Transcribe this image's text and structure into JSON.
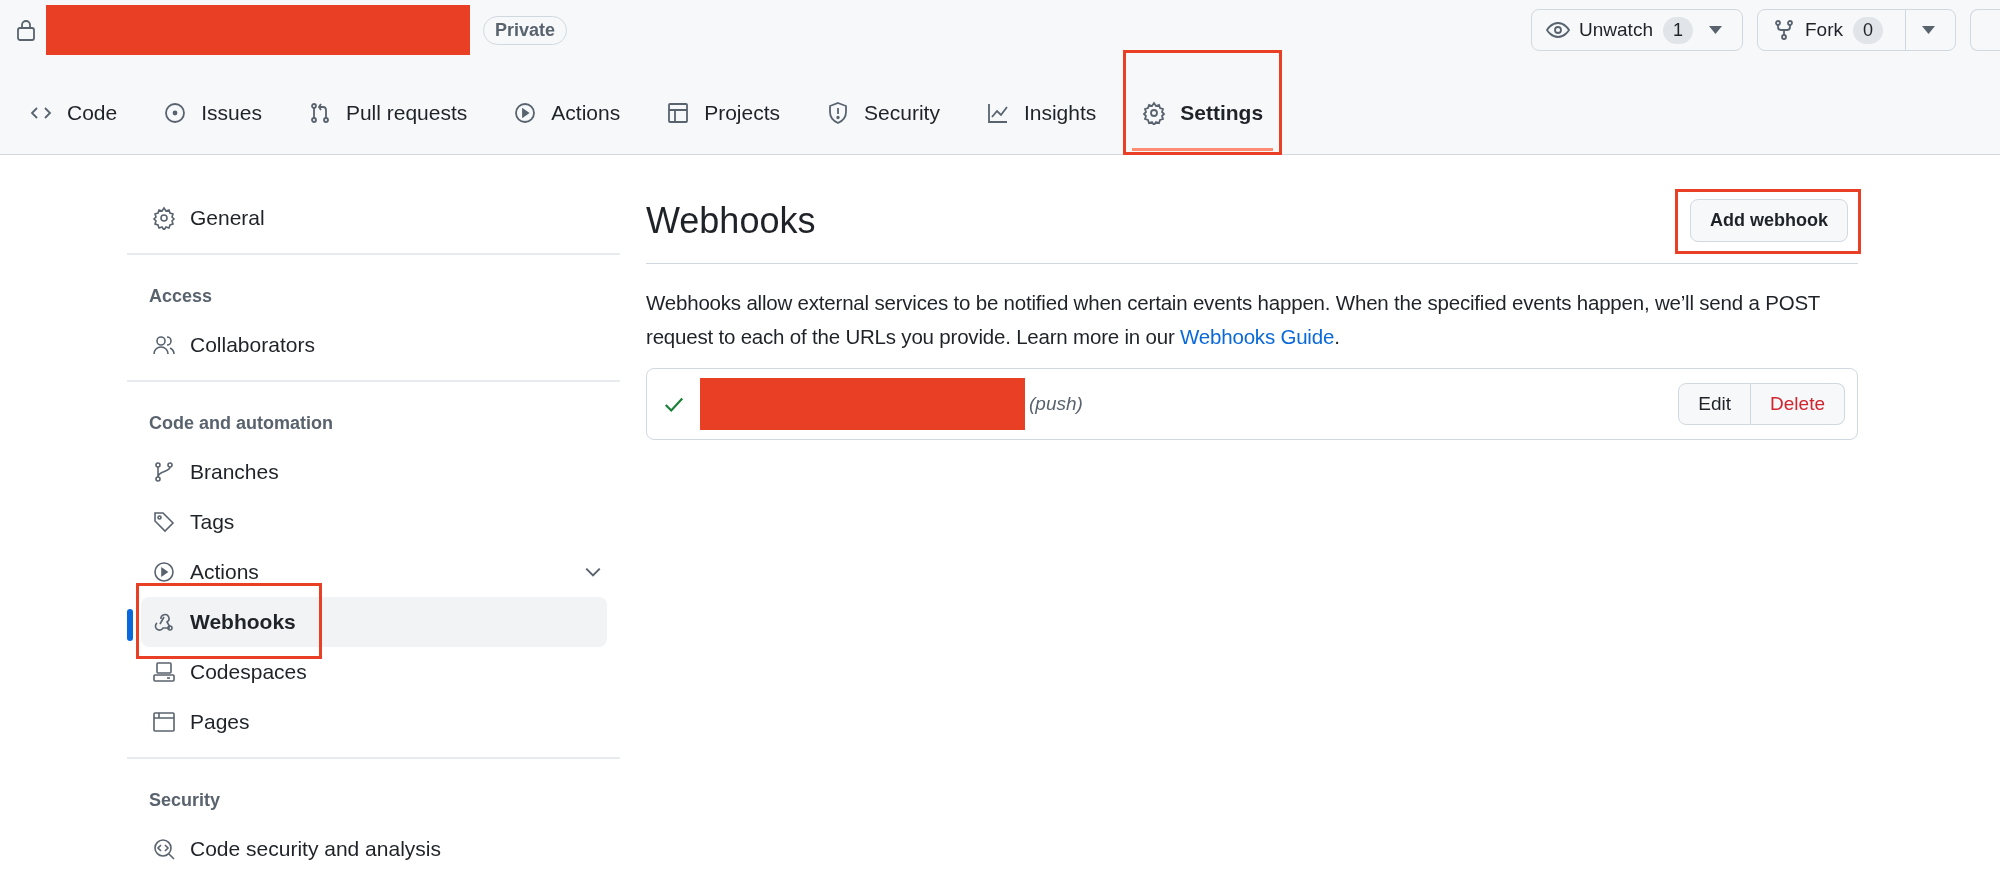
{
  "repo": {
    "visibility": "Private"
  },
  "header_buttons": [
    {
      "label": "Unwatch",
      "count": "1"
    },
    {
      "label": "Fork",
      "count": "0"
    }
  ],
  "tabs": [
    {
      "label": "Code",
      "selected": false,
      "highlighted": false
    },
    {
      "label": "Issues",
      "selected": false,
      "highlighted": false
    },
    {
      "label": "Pull requests",
      "selected": false,
      "highlighted": false
    },
    {
      "label": "Actions",
      "selected": false,
      "highlighted": false
    },
    {
      "label": "Projects",
      "selected": false,
      "highlighted": false
    },
    {
      "label": "Security",
      "selected": false,
      "highlighted": false
    },
    {
      "label": "Insights",
      "selected": false,
      "highlighted": false
    },
    {
      "label": "Settings",
      "selected": true,
      "highlighted": true
    }
  ],
  "sidebar": {
    "sections": [
      {
        "items": [
          {
            "label": "General",
            "selected": false,
            "highlighted": false
          }
        ]
      },
      {
        "heading": "Access",
        "items": [
          {
            "label": "Collaborators",
            "selected": false,
            "highlighted": false
          }
        ]
      },
      {
        "heading": "Code and automation",
        "items": [
          {
            "label": "Branches",
            "selected": false,
            "highlighted": false
          },
          {
            "label": "Tags",
            "selected": false,
            "highlighted": false
          },
          {
            "label": "Actions",
            "selected": false,
            "highlighted": false,
            "expanded": false
          },
          {
            "label": "Webhooks",
            "selected": true,
            "highlighted": true
          },
          {
            "label": "Codespaces",
            "selected": false,
            "highlighted": false
          },
          {
            "label": "Pages",
            "selected": false,
            "highlighted": false
          }
        ]
      },
      {
        "heading": "Security",
        "items": [
          {
            "label": "Code security and analysis",
            "selected": false,
            "highlighted": false
          }
        ]
      }
    ]
  },
  "main": {
    "title": "Webhooks",
    "add_button": {
      "label": "Add webhook",
      "highlighted": true
    },
    "description": "Webhooks allow external services to be notified when certain events happen. When the specified events happen, we’ll send a POST request to each of the URLs you provide. Learn more in our ",
    "link": "Webhooks Guide",
    "description_end": ".",
    "webhooks": [
      {
        "active": true,
        "events": "(push)",
        "actions": [
          "Edit",
          "Delete"
        ]
      }
    ]
  }
}
